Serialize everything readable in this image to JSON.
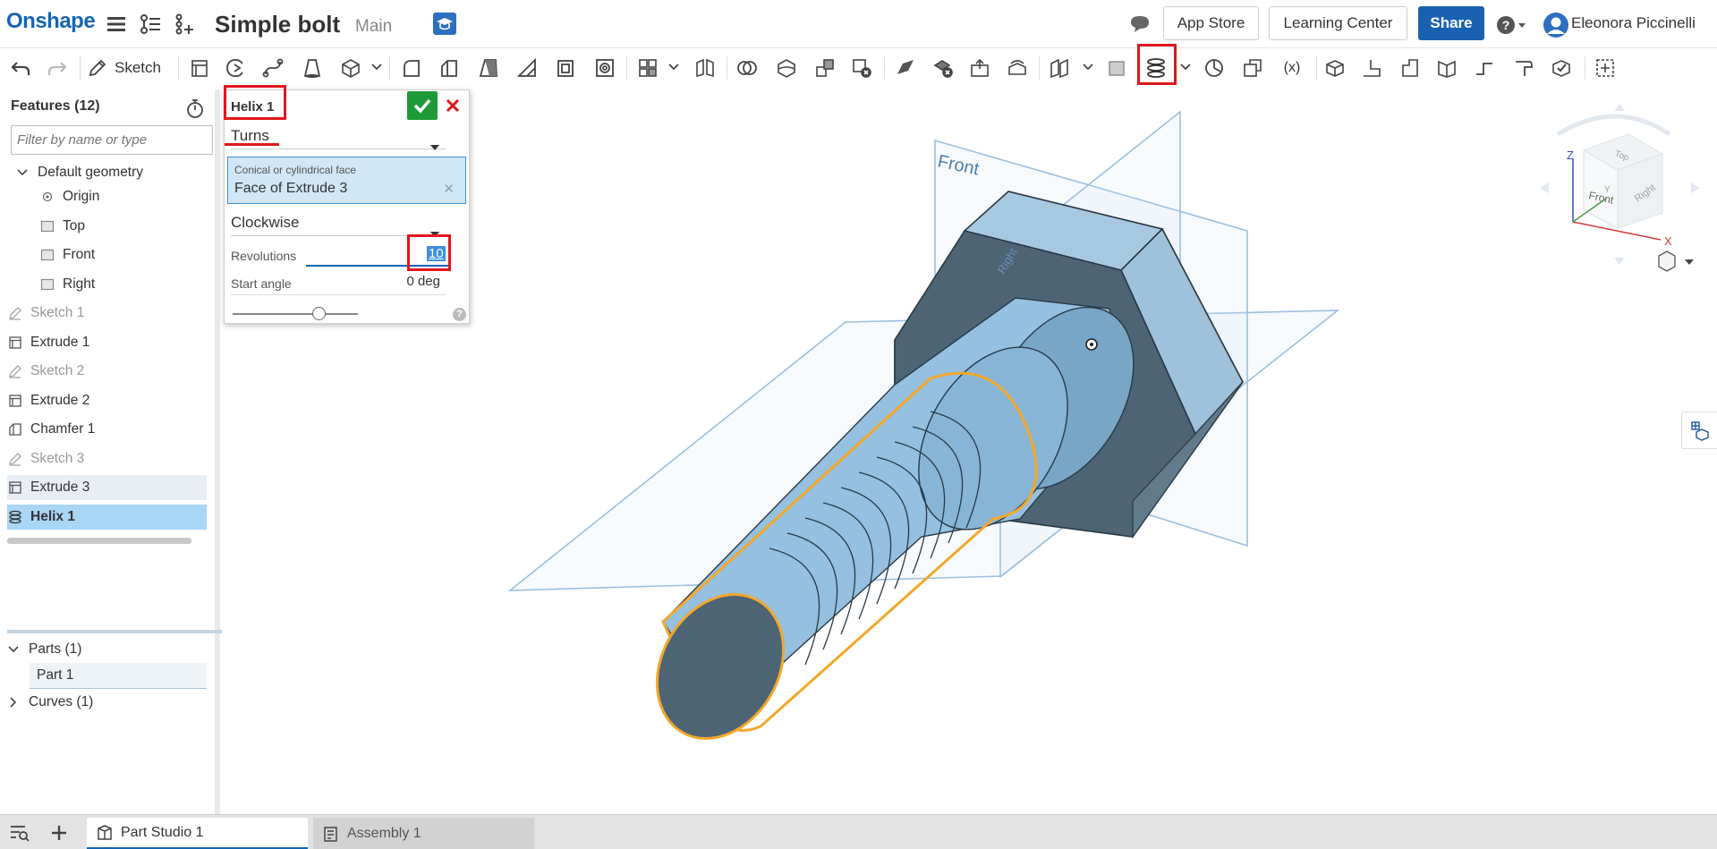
{
  "header": {
    "logo": "Onshape",
    "document_title": "Simple bolt",
    "branch": "Main",
    "buttons": {
      "app_store": "App Store",
      "learning_center": "Learning Center",
      "share": "Share"
    },
    "user_name": "Eleonora Piccinelli"
  },
  "toolbar": {
    "sketch_label": "Sketch",
    "variable_label": "(x)",
    "highlighted_tool": "helix-icon"
  },
  "features": {
    "title": "Features (12)",
    "filter_placeholder": "Filter by name or type",
    "default_geometry": "Default geometry",
    "items": [
      {
        "label": "Origin",
        "icon": "origin-icon",
        "dim": false
      },
      {
        "label": "Top",
        "icon": "plane-icon",
        "dim": false
      },
      {
        "label": "Front",
        "icon": "plane-icon",
        "dim": false
      },
      {
        "label": "Right",
        "icon": "plane-icon",
        "dim": false
      },
      {
        "label": "Sketch 1",
        "icon": "sketch-icon",
        "dim": true
      },
      {
        "label": "Extrude 1",
        "icon": "extrude-icon",
        "dim": false
      },
      {
        "label": "Sketch 2",
        "icon": "sketch-icon",
        "dim": true
      },
      {
        "label": "Extrude 2",
        "icon": "extrude-icon",
        "dim": false
      },
      {
        "label": "Chamfer 1",
        "icon": "chamfer-icon",
        "dim": false
      },
      {
        "label": "Sketch 3",
        "icon": "sketch-icon",
        "dim": true
      },
      {
        "label": "Extrude 3",
        "icon": "extrude-icon",
        "dim": false
      },
      {
        "label": "Helix 1",
        "icon": "helix-icon",
        "dim": false
      }
    ],
    "parts_label": "Parts (1)",
    "part_1": "Part 1",
    "curves_label": "Curves (1)"
  },
  "dialog": {
    "title": "Helix 1",
    "mode": "Turns",
    "face_label": "Conical or cylindrical face",
    "face_value": "Face of Extrude 3",
    "direction": "Clockwise",
    "revolutions_label": "Revolutions",
    "revolutions_value": "10",
    "start_angle_label": "Start angle",
    "start_angle_value": "0 deg",
    "help": "?"
  },
  "viewport": {
    "plane_front": "Front",
    "plane_right": "Right",
    "view_cube": {
      "top": "Top",
      "front": "Front",
      "right": "Right",
      "axis_x": "X",
      "axis_y": "Y",
      "axis_z": "Z"
    }
  },
  "tabs": [
    {
      "label": "Part Studio 1",
      "active": true
    },
    {
      "label": "Assembly 1",
      "active": false
    }
  ],
  "colors": {
    "brand": "#1565b4",
    "share": "#1a62b0",
    "highlight": "#e0161c",
    "part_fill": "#93bfdc",
    "part_dark": "#4a6070",
    "selection": "#f4a72a",
    "tree_selected": "#a9d6f5",
    "ok_green": "#1f9a38"
  }
}
